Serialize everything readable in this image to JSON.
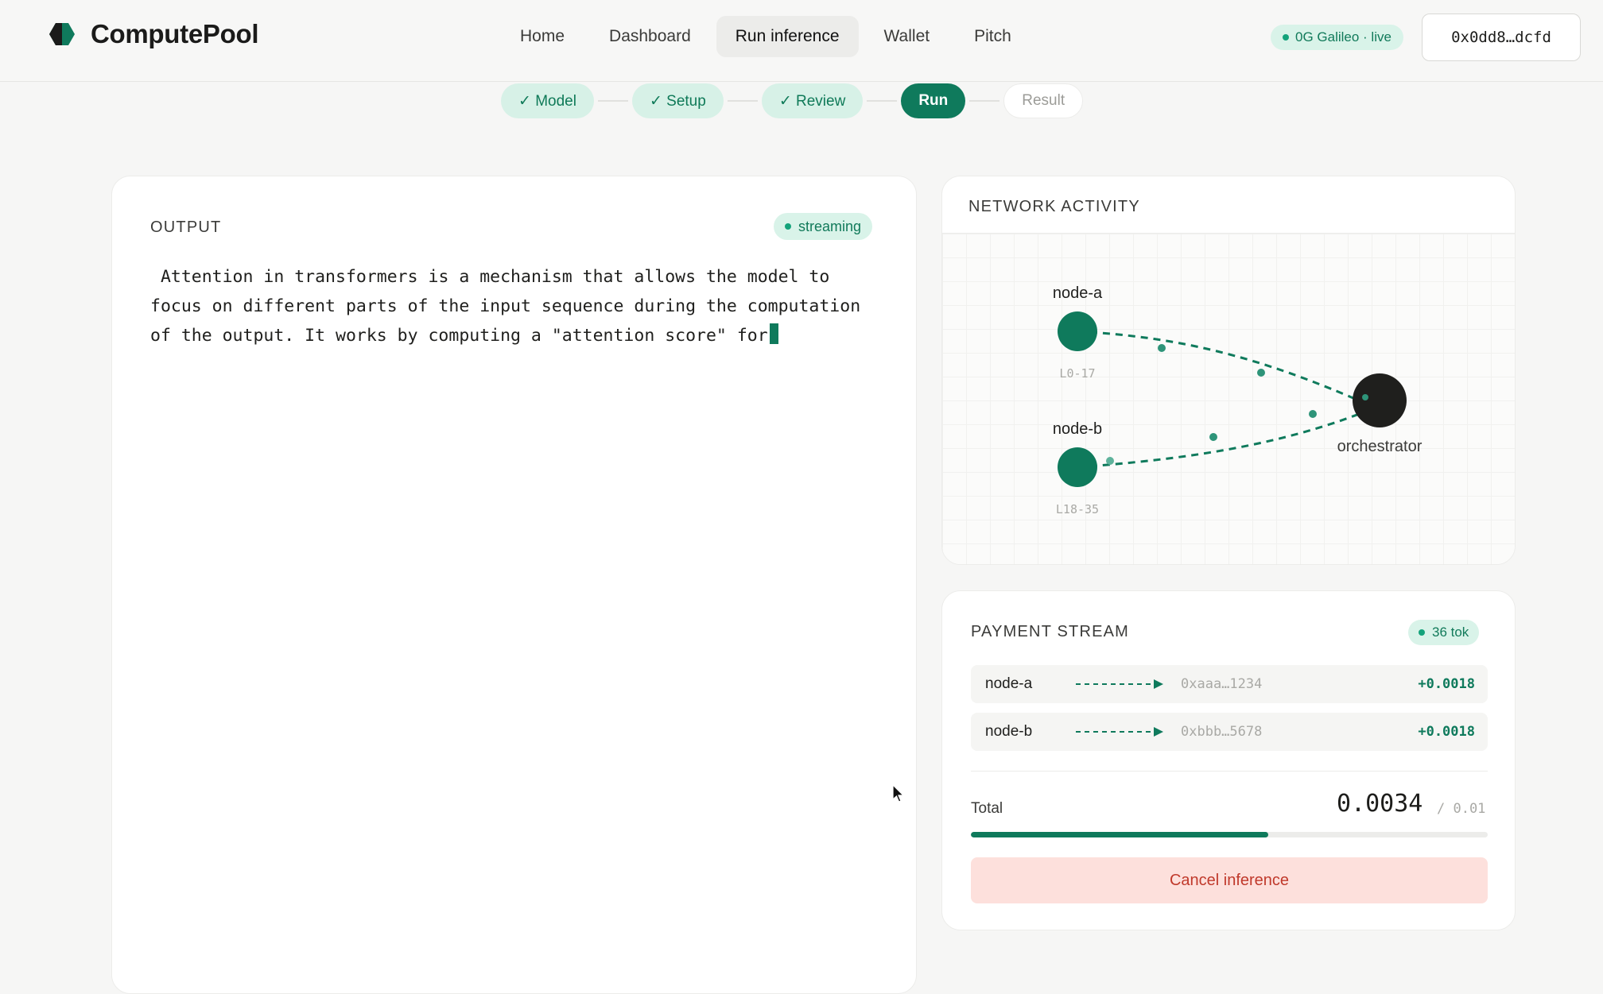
{
  "brand": {
    "name": "ComputePool",
    "color": "#1b1b1a"
  },
  "nav": {
    "items": [
      {
        "label": "Home",
        "active": false
      },
      {
        "label": "Dashboard",
        "active": false
      },
      {
        "label": "Run inference",
        "active": true
      },
      {
        "label": "Wallet",
        "active": false
      },
      {
        "label": "Pitch",
        "active": false
      }
    ]
  },
  "network_badge": {
    "label": "0G Galileo · live"
  },
  "wallet": {
    "address": "0x0dd8…dcfd"
  },
  "stepper": {
    "steps": [
      {
        "label": "✓ Model",
        "state": "done"
      },
      {
        "label": "✓ Setup",
        "state": "done"
      },
      {
        "label": "✓ Review",
        "state": "done"
      },
      {
        "label": "Run",
        "state": "current"
      },
      {
        "label": "Result",
        "state": "pending"
      }
    ]
  },
  "output": {
    "title": "OUTPUT",
    "status": "streaming",
    "text": " Attention in transformers is a mechanism that allows the model to focus on different parts of the input sequence during the computation of the output. It works by computing a \"attention score\" for"
  },
  "network": {
    "title": "NETWORK ACTIVITY",
    "nodes": [
      {
        "name": "node-a",
        "layers": "L0-17"
      },
      {
        "name": "node-b",
        "layers": "L18-35"
      }
    ],
    "orchestrator": "orchestrator"
  },
  "payment": {
    "title": "PAYMENT STREAM",
    "tokens": "36 tok",
    "rows": [
      {
        "node": "node-a",
        "address": "0xaaa…1234",
        "amount": "+0.0018"
      },
      {
        "node": "node-b",
        "address": "0xbbb…5678",
        "amount": "+0.0018"
      }
    ],
    "total_label": "Total",
    "total": "0.0034",
    "cap": "/ 0.01",
    "progress_fraction": 0.575,
    "cancel_label": "Cancel inference"
  },
  "colors": {
    "accent": "#0f7a5c",
    "accent_light": "#d9f3e9",
    "danger": "#c0392b",
    "danger_bg": "#fde0dc"
  }
}
